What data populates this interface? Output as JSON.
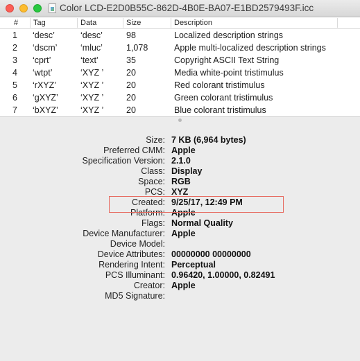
{
  "window": {
    "title": "Color LCD-E2D0B55C-862D-4B0E-BA07-E1BD2579493F.icc"
  },
  "table": {
    "columns": [
      "#",
      "Tag",
      "Data",
      "Size",
      "Description"
    ],
    "rows": [
      {
        "num": "1",
        "tag": "‘desc’",
        "data": "‘desc’",
        "size": "98",
        "description": "Localized description strings"
      },
      {
        "num": "2",
        "tag": "‘dscm’",
        "data": "‘mluc’",
        "size": "1,078",
        "description": "Apple multi-localized description strings"
      },
      {
        "num": "3",
        "tag": "‘cprt’",
        "data": "‘text’",
        "size": "35",
        "description": "Copyright ASCII Text String"
      },
      {
        "num": "4",
        "tag": "‘wtpt’",
        "data": "‘XYZ ’",
        "size": "20",
        "description": "Media white-point tristimulus"
      },
      {
        "num": "5",
        "tag": "‘rXYZ’",
        "data": "‘XYZ ’",
        "size": "20",
        "description": "Red colorant tristimulus"
      },
      {
        "num": "6",
        "tag": "‘gXYZ’",
        "data": "‘XYZ ’",
        "size": "20",
        "description": "Green colorant tristimulus"
      },
      {
        "num": "7",
        "tag": "‘bXYZ’",
        "data": "‘XYZ ’",
        "size": "20",
        "description": "Blue colorant tristimulus"
      }
    ]
  },
  "properties": [
    {
      "label": "Size:",
      "value": "7 KB (6,964 bytes)"
    },
    {
      "label": "Preferred CMM:",
      "value": "Apple"
    },
    {
      "label": "Specification Version:",
      "value": "2.1.0"
    },
    {
      "label": "Class:",
      "value": "Display"
    },
    {
      "label": "Space:",
      "value": "RGB"
    },
    {
      "label": "PCS:",
      "value": "XYZ"
    },
    {
      "label": "Created:",
      "value": "9/25/17, 12:49 PM"
    },
    {
      "label": "Platform:",
      "value": "Apple"
    },
    {
      "label": "Flags:",
      "value": "Normal Quality"
    },
    {
      "label": "Device Manufacturer:",
      "value": "Apple"
    },
    {
      "label": "Device Model:",
      "value": ""
    },
    {
      "label": "Device Attributes:",
      "value": "00000000 00000000"
    },
    {
      "label": "Rendering Intent:",
      "value": "Perceptual"
    },
    {
      "label": "PCS Illuminant:",
      "value": "0.96420, 1.00000, 0.82491"
    },
    {
      "label": "Creator:",
      "value": "Apple"
    },
    {
      "label": "MD5 Signature:",
      "value": ""
    }
  ],
  "colors": {
    "highlight": "#e76a60",
    "close": "#fc5f57",
    "minimize": "#fdbc2e",
    "maximize": "#28c840"
  }
}
